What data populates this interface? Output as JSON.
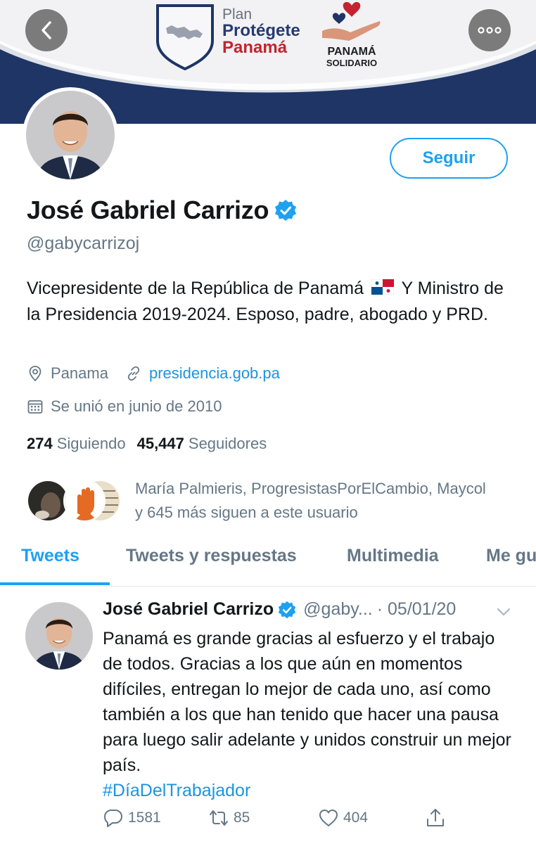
{
  "banner": {
    "plan_word": "Plan",
    "plan_protegete": "Protégete",
    "plan_panama": "Panamá",
    "solidario_line1": "PANAMÁ",
    "solidario_line2": "SOLIDARIO",
    "colors": {
      "navy": "#1e3565",
      "red": "#c4232f"
    }
  },
  "profile": {
    "follow_label": "Seguir",
    "display_name": "José Gabriel Carrizo",
    "handle": "@gabycarrizoj",
    "bio_part1": "Vicepresidente de la República de Panamá",
    "bio_part2": "Y Ministro de la Presidencia 2019-2024. Esposo, padre, abogado y PRD.",
    "location": "Panama",
    "website": "presidencia.gob.pa",
    "joined": "Se unió en junio de 2010",
    "following_count": "274",
    "following_label": "Siguiendo",
    "followers_count": "45,447",
    "followers_label": "Seguidores",
    "followed_by_text": "María Palmieris, ProgresistasPorElCambio, Maycol y 645 más siguen a este usuario"
  },
  "tabs": [
    {
      "label": "Tweets"
    },
    {
      "label": "Tweets y respuestas"
    },
    {
      "label": "Multimedia"
    },
    {
      "label": "Me gu"
    }
  ],
  "tweet": {
    "name": "José Gabriel Carrizo",
    "handle": "@gaby...",
    "date": "· 05/01/20",
    "text": "Panamá es grande gracias al esfuerzo y el trabajo de todos. Gracias a los que aún en momentos difíciles, entregan lo mejor de cada uno, así como también a los que han tenido que hacer una pausa para luego salir adelante y unidos construir un mejor país.",
    "hashtag": "#DíaDelTrabajador",
    "replies": "1581",
    "retweets": "85",
    "likes": "404"
  },
  "icons": {
    "back": "chevron-left-icon",
    "more": "more-horizontal-icon",
    "verified": "verified-badge-icon",
    "location": "location-pin-icon",
    "link": "link-icon",
    "calendar": "calendar-icon",
    "reply": "reply-icon",
    "retweet": "retweet-icon",
    "like": "heart-icon",
    "share": "share-icon"
  },
  "accent_color": "#1da1f2"
}
